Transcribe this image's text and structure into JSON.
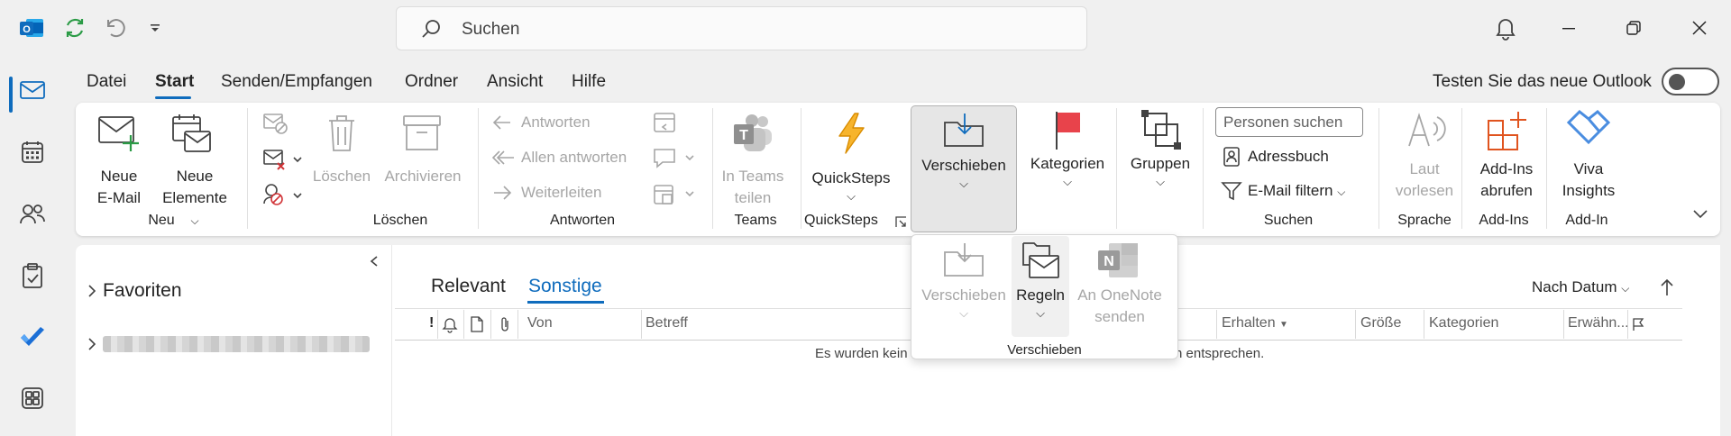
{
  "titlebar": {
    "search_placeholder": "Suchen",
    "icons": [
      "outlook-icon",
      "sync-icon",
      "undo-icon",
      "customize-qat-icon",
      "bell-icon",
      "minimize-icon",
      "restore-icon",
      "close-icon"
    ]
  },
  "rail": {
    "items": [
      "mail-icon",
      "calendar-icon",
      "people-icon",
      "tasks-icon",
      "todo-icon",
      "apps-icon"
    ],
    "selected": "mail-icon"
  },
  "menu": {
    "tabs": [
      "Datei",
      "Start",
      "Senden/Empfangen",
      "Ordner",
      "Ansicht",
      "Hilfe"
    ],
    "active": "Start",
    "trial_label": "Testen Sie das neue Outlook"
  },
  "ribbon": {
    "neu": {
      "group": "Neu",
      "new_email": [
        "Neue",
        "E-Mail"
      ],
      "new_items": [
        "Neue",
        "Elemente"
      ]
    },
    "loeschen": {
      "group": "Löschen",
      "delete": "Löschen",
      "archive": "Archivieren"
    },
    "antworten": {
      "group": "Antworten",
      "reply": "Antworten",
      "reply_all": "Allen antworten",
      "forward": "Weiterleiten"
    },
    "teams": {
      "group": "Teams",
      "share": [
        "In Teams",
        "teilen"
      ]
    },
    "quicksteps": {
      "group": "QuickSteps",
      "label": "QuickSteps"
    },
    "verschieben": {
      "label": "Verschieben"
    },
    "kategorien": {
      "label": "Kategorien"
    },
    "gruppen": {
      "label": "Gruppen"
    },
    "suchen": {
      "group": "Suchen",
      "people_placeholder": "Personen suchen",
      "address_book": "Adressbuch",
      "filter_email": "E-Mail filtern"
    },
    "sprache": {
      "group": "Sprache",
      "read_aloud": [
        "Laut",
        "vorlesen"
      ]
    },
    "addins": {
      "group": "Add-Ins",
      "get_addins": [
        "Add-Ins",
        "abrufen"
      ]
    },
    "insights": {
      "group": "Add-In",
      "label": [
        "Viva",
        "Insights"
      ]
    }
  },
  "popup": {
    "group": "Verschieben",
    "move": "Verschieben",
    "rules": "Regeln",
    "onenote": [
      "An OneNote",
      "senden"
    ]
  },
  "navpane": {
    "favorites": "Favoriten"
  },
  "list": {
    "tabs": [
      "Relevant",
      "Sonstige"
    ],
    "active_tab": "Sonstige",
    "sort_label": "Nach Datum",
    "columns": {
      "from": "Von",
      "subject": "Betreff",
      "received": "Erhalten",
      "size": "Größe",
      "categories": "Kategorien",
      "mentions": "Erwähn..."
    },
    "empty_left": "Es wurden kein",
    "empty_right": "n entsprechen."
  },
  "colors": {
    "accent": "#0f6cbd",
    "flag": "#e8434b",
    "quicksteps": "#f2a20c",
    "addins": "#e0541f",
    "insights": "#4a8de0"
  }
}
